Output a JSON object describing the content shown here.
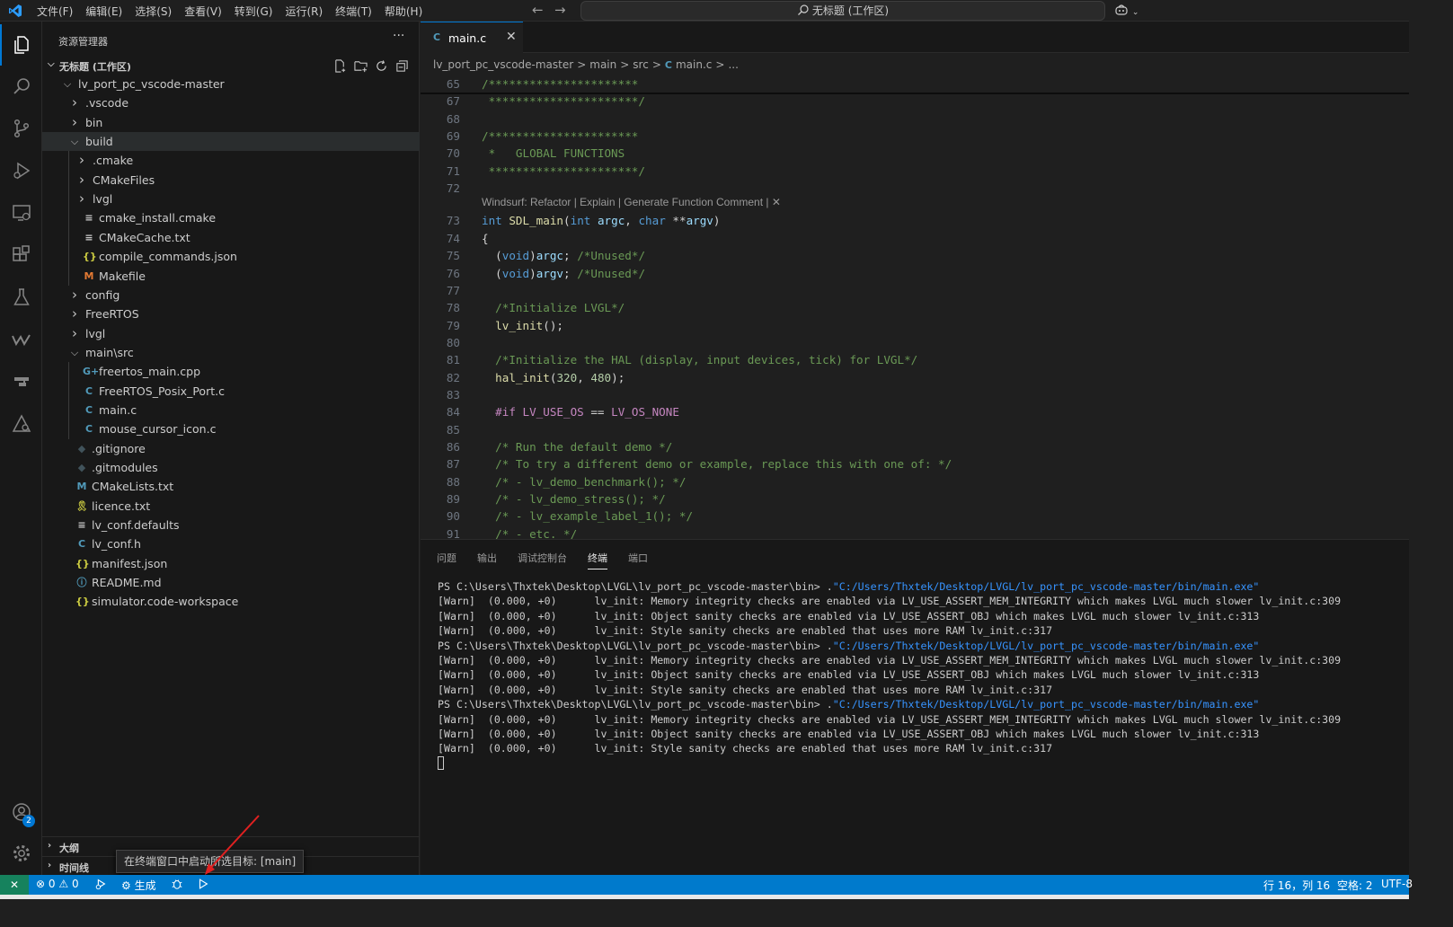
{
  "menu": [
    "文件(F)",
    "编辑(E)",
    "选择(S)",
    "查看(V)",
    "转到(G)",
    "运行(R)",
    "终端(T)",
    "帮助(H)"
  ],
  "search": {
    "text": "无标题 (工作区)"
  },
  "explorer": {
    "title": "资源管理器",
    "more": "···",
    "workspace": "无标题 (工作区)",
    "items": [
      {
        "label": "lv_port_pc_vscode-master",
        "type": "folder",
        "open": true
      },
      {
        "label": ".vscode",
        "type": "folder"
      },
      {
        "label": "bin",
        "type": "folder"
      },
      {
        "label": "build",
        "type": "folder",
        "open": true
      },
      {
        "label": ".cmake",
        "type": "folder"
      },
      {
        "label": "CMakeFiles",
        "type": "folder"
      },
      {
        "label": "lvgl",
        "type": "folder"
      },
      {
        "label": "cmake_install.cmake",
        "type": "lines"
      },
      {
        "label": "CMakeCache.txt",
        "type": "lines"
      },
      {
        "label": "compile_commands.json",
        "type": "json"
      },
      {
        "label": "Makefile",
        "type": "makefile"
      },
      {
        "label": "config",
        "type": "folder"
      },
      {
        "label": "FreeRTOS",
        "type": "folder"
      },
      {
        "label": "lvgl",
        "type": "folder"
      },
      {
        "label": "main\\src",
        "type": "folder",
        "open": true
      },
      {
        "label": "freertos_main.cpp",
        "type": "cpp"
      },
      {
        "label": "FreeRTOS_Posix_Port.c",
        "type": "c"
      },
      {
        "label": "main.c",
        "type": "c"
      },
      {
        "label": "mouse_cursor_icon.c",
        "type": "c"
      },
      {
        "label": ".gitignore",
        "type": "git"
      },
      {
        "label": ".gitmodules",
        "type": "git"
      },
      {
        "label": "CMakeLists.txt",
        "type": "cmake"
      },
      {
        "label": "licence.txt",
        "type": "licence"
      },
      {
        "label": "lv_conf.defaults",
        "type": "lines"
      },
      {
        "label": "lv_conf.h",
        "type": "c"
      },
      {
        "label": "manifest.json",
        "type": "json"
      },
      {
        "label": "README.md",
        "type": "info"
      },
      {
        "label": "simulator.code-workspace",
        "type": "json"
      }
    ],
    "outline": "大纲",
    "timeline": "时间线"
  },
  "editor": {
    "tab": {
      "icon": "C",
      "label": "main.c",
      "close": "✕"
    },
    "breadcrumb": [
      "lv_port_pc_vscode-master",
      ">",
      "main",
      ">",
      "src",
      ">",
      "C",
      "main.c",
      ">",
      "..."
    ],
    "codelens": "Windsurf: Refactor | Explain | Generate Function Comment | ✕",
    "lines": [
      {
        "n": "65",
        "t": "/**********************"
      },
      {
        "n": "67",
        "t": " **********************/"
      },
      {
        "n": "68",
        "t": ""
      },
      {
        "n": "69",
        "t": "/**********************"
      },
      {
        "n": "70",
        "t": " *   GLOBAL FUNCTIONS"
      },
      {
        "n": "71",
        "t": " **********************/"
      },
      {
        "n": "72",
        "t": ""
      },
      {
        "n": "73",
        "t": "int SDL_main(int argc, char **argv)"
      },
      {
        "n": "74",
        "t": "{"
      },
      {
        "n": "75",
        "t": "  (void)argc; /*Unused*/"
      },
      {
        "n": "76",
        "t": "  (void)argv; /*Unused*/"
      },
      {
        "n": "77",
        "t": ""
      },
      {
        "n": "78",
        "t": "  /*Initialize LVGL*/"
      },
      {
        "n": "79",
        "t": "  lv_init();"
      },
      {
        "n": "80",
        "t": ""
      },
      {
        "n": "81",
        "t": "  /*Initialize the HAL (display, input devices, tick) for LVGL*/"
      },
      {
        "n": "82",
        "t": "  hal_init(320, 480);"
      },
      {
        "n": "83",
        "t": ""
      },
      {
        "n": "84",
        "t": "  #if LV_USE_OS == LV_OS_NONE"
      },
      {
        "n": "85",
        "t": ""
      },
      {
        "n": "86",
        "t": "  /* Run the default demo */"
      },
      {
        "n": "87",
        "t": "  /* To try a different demo or example, replace this with one of: */"
      },
      {
        "n": "88",
        "t": "  /* - lv_demo_benchmark(); */"
      },
      {
        "n": "89",
        "t": "  /* - lv_demo_stress(); */"
      },
      {
        "n": "90",
        "t": "  /* - lv_example_label_1(); */"
      },
      {
        "n": "91",
        "t": "  /* - etc. */"
      }
    ]
  },
  "panel": {
    "tabs": [
      "问题",
      "输出",
      "调试控制台",
      "终端",
      "端口"
    ],
    "active_tab": "终端",
    "terminal": {
      "prompt": "PS C:\\Users\\Thxtek\\Desktop\\LVGL\\lv_port_pc_vscode-master\\bin> ",
      "command_prefix": ".",
      "command_path": "\"C:/Users/Thxtek/Desktop/LVGL/lv_port_pc_vscode-master/bin/main.exe\"",
      "warn1": "[Warn]  (0.000, +0)      lv_init: Memory integrity checks are enabled via LV_USE_ASSERT_MEM_INTEGRITY which makes LVGL much slower lv_init.c:309",
      "warn2": "[Warn]  (0.000, +0)      lv_init: Object sanity checks are enabled via LV_USE_ASSERT_OBJ which makes LVGL much slower lv_init.c:313",
      "warn3": "[Warn]  (0.000, +0)      lv_init: Style sanity checks are enabled that uses more RAM lv_init.c:317"
    }
  },
  "tooltip": "在终端窗口中启动所选目标: [main]",
  "status": {
    "remote": "✕",
    "errors": "0",
    "warnings": "0",
    "build": "生成",
    "position": "行 16，列 16",
    "spaces": "空格: 2",
    "encoding": "UTF-8"
  },
  "accounts_badge": "2",
  "colors": {
    "accent": "#0078d4",
    "statusbar": "#007acc",
    "remote": "#16825d"
  }
}
